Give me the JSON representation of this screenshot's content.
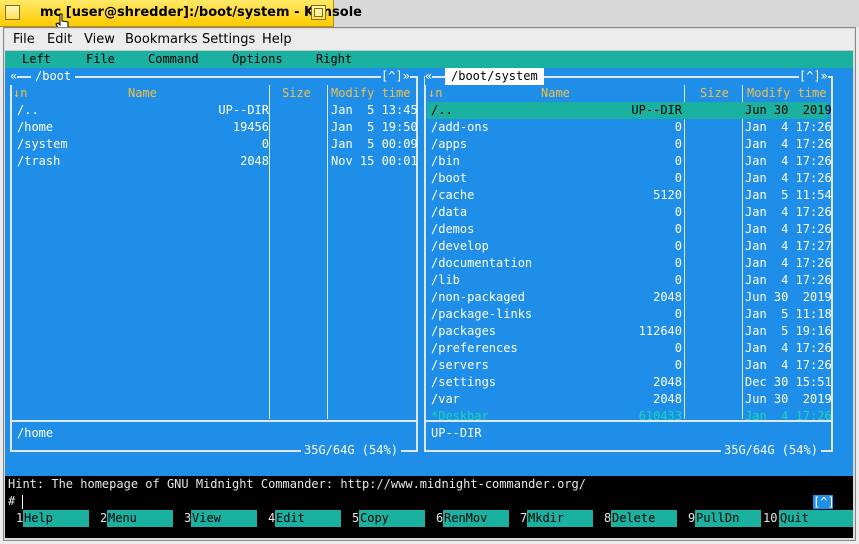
{
  "window": {
    "title": "mc [user@shredder]:/boot/system - Konsole"
  },
  "konsole_menu": [
    "File",
    "Edit",
    "View",
    "Bookmarks",
    "Settings",
    "Help"
  ],
  "mc_menu": [
    "Left",
    "File",
    "Command",
    "Options",
    "Right"
  ],
  "left_panel": {
    "path": "/boot",
    "corner_left": "«",
    "corner_right": "[^]»",
    "headers": {
      "name": "Name",
      "size": "Size",
      "modify": "Modify time",
      "sort": "↓n"
    },
    "rows": [
      {
        "name": "/..",
        "size": "UP--DIR",
        "date": "Jan  5 13:45"
      },
      {
        "name": "/home",
        "size": "19456",
        "date": "Jan  5 19:50"
      },
      {
        "name": "/system",
        "size": "0",
        "date": "Jan  5 00:09"
      },
      {
        "name": "/trash",
        "size": "2048",
        "date": "Nov 15 00:01"
      }
    ],
    "status": "/home",
    "disk": "35G/64G (54%)"
  },
  "right_panel": {
    "path": "/boot/system",
    "corner_left": "«",
    "corner_right": "[^]»",
    "headers": {
      "name": "Name",
      "size": "Size",
      "modify": "Modify time",
      "sort": "↓n"
    },
    "rows": [
      {
        "name": "/..",
        "size": "UP--DIR",
        "date": "Jun 30  2019",
        "selected": true
      },
      {
        "name": "/add-ons",
        "size": "0",
        "date": "Jan  4 17:26"
      },
      {
        "name": "/apps",
        "size": "0",
        "date": "Jan  4 17:26"
      },
      {
        "name": "/bin",
        "size": "0",
        "date": "Jan  4 17:26"
      },
      {
        "name": "/boot",
        "size": "0",
        "date": "Jan  4 17:26"
      },
      {
        "name": "/cache",
        "size": "5120",
        "date": "Jan  5 11:54"
      },
      {
        "name": "/data",
        "size": "0",
        "date": "Jan  4 17:26"
      },
      {
        "name": "/demos",
        "size": "0",
        "date": "Jan  4 17:26"
      },
      {
        "name": "/develop",
        "size": "0",
        "date": "Jan  4 17:27"
      },
      {
        "name": "/documentation",
        "size": "0",
        "date": "Jan  4 17:26"
      },
      {
        "name": "/lib",
        "size": "0",
        "date": "Jan  4 17:26"
      },
      {
        "name": "/non-packaged",
        "size": "2048",
        "date": "Jun 30  2019"
      },
      {
        "name": "/package-links",
        "size": "0",
        "date": "Jan  5 11:18"
      },
      {
        "name": "/packages",
        "size": "112640",
        "date": "Jan  5 19:16"
      },
      {
        "name": "/preferences",
        "size": "0",
        "date": "Jan  4 17:26"
      },
      {
        "name": "/servers",
        "size": "0",
        "date": "Jan  4 17:26"
      },
      {
        "name": "/settings",
        "size": "2048",
        "date": "Dec 30 15:51"
      },
      {
        "name": "/var",
        "size": "2048",
        "date": "Jun 30  2019"
      },
      {
        "name": "*Deskbar",
        "size": "610433",
        "date": "Jan  4 17:26",
        "dim": true
      }
    ],
    "status": "UP--DIR",
    "disk": "35G/64G (54%)"
  },
  "hint": "Hint: The homepage of GNU Midnight Commander: http://www.midnight-commander.org/",
  "prompt": "#",
  "resize_badge": "[^]",
  "fkeys": [
    {
      "num": "1",
      "label": "Help"
    },
    {
      "num": "2",
      "label": "Menu"
    },
    {
      "num": "3",
      "label": "View"
    },
    {
      "num": "4",
      "label": "Edit"
    },
    {
      "num": "5",
      "label": "Copy"
    },
    {
      "num": "6",
      "label": "RenMov"
    },
    {
      "num": "7",
      "label": "Mkdir"
    },
    {
      "num": "8",
      "label": "Delete"
    },
    {
      "num": "9",
      "label": "PullDn"
    },
    {
      "num": "10",
      "label": "Quit"
    }
  ],
  "colors": {
    "panel_bg": "#1e8ee8",
    "selection": "#1ab1a0",
    "header_text": "#f0c04a",
    "title_tab": "#ffd800"
  }
}
